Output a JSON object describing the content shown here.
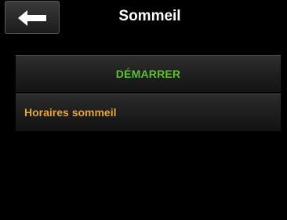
{
  "header": {
    "title": "Sommeil",
    "back_icon": "arrow-left-icon"
  },
  "menu": {
    "start_label": "DÉMARRER",
    "schedule_label": "Horaires sommeil"
  },
  "colors": {
    "start_text": "#59c22e",
    "schedule_text": "#e6a53b",
    "background": "#000000"
  }
}
